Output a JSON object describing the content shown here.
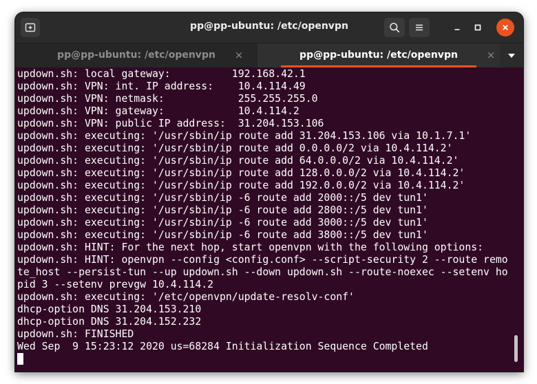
{
  "window": {
    "title": "pp@pp-ubuntu: /etc/openvpn"
  },
  "titlebar": {
    "new_tab_icon": "new-tab-icon",
    "search_icon": "search-icon",
    "menu_icon": "hamburger-menu-icon",
    "minimize_icon": "minimize-icon",
    "maximize_icon": "maximize-icon",
    "close_icon": "close-icon",
    "close_color": "#e95420"
  },
  "tabs": [
    {
      "label": "pp@pp-ubuntu: /etc/openvpn",
      "active": false,
      "close_glyph": "×"
    },
    {
      "label": "pp@pp-ubuntu: /etc/openvpn",
      "active": true,
      "close_glyph": "×"
    }
  ],
  "terminal": {
    "background": "#300a24",
    "lines": [
      "updown.sh: local gateway:          192.168.42.1",
      "updown.sh: VPN: int. IP address:    10.4.114.49",
      "updown.sh: VPN: netmask:            255.255.255.0",
      "updown.sh: VPN: gateway:            10.4.114.2",
      "updown.sh: VPN: public IP address:  31.204.153.106",
      "updown.sh: executing: '/usr/sbin/ip route add 31.204.153.106 via 10.1.7.1'",
      "updown.sh: executing: '/usr/sbin/ip route add 0.0.0.0/2 via 10.4.114.2'",
      "updown.sh: executing: '/usr/sbin/ip route add 64.0.0.0/2 via 10.4.114.2'",
      "updown.sh: executing: '/usr/sbin/ip route add 128.0.0.0/2 via 10.4.114.2'",
      "updown.sh: executing: '/usr/sbin/ip route add 192.0.0.0/2 via 10.4.114.2'",
      "updown.sh: executing: '/usr/sbin/ip -6 route add 2000::/5 dev tun1'",
      "updown.sh: executing: '/usr/sbin/ip -6 route add 2800::/5 dev tun1'",
      "updown.sh: executing: '/usr/sbin/ip -6 route add 3000::/5 dev tun1'",
      "updown.sh: executing: '/usr/sbin/ip -6 route add 3800::/5 dev tun1'",
      "updown.sh: HINT: For the next hop, start openvpn with the following options:",
      "updown.sh: HINT: openvpn --config <config.conf> --script-security 2 --route remo",
      "te_host --persist-tun --up updown.sh --down updown.sh --route-noexec --setenv ho",
      "pid 3 --setenv prevgw 10.4.114.2",
      "updown.sh: executing: '/etc/openvpn/update-resolv-conf'",
      "dhcp-option DNS 31.204.153.210",
      "dhcp-option DNS 31.204.152.232",
      "updown.sh: FINISHED",
      "Wed Sep  9 15:23:12 2020 us=68284 Initialization Sequence Completed"
    ]
  }
}
